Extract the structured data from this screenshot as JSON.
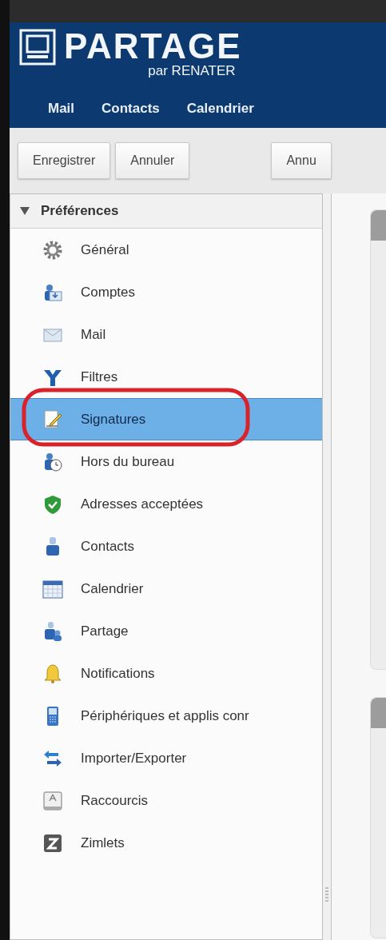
{
  "header": {
    "logo": "PARTAGE",
    "logo_subtitle": "par RENATER"
  },
  "nav": [
    {
      "label": "Mail",
      "selected": false
    },
    {
      "label": "Contacts",
      "selected": false
    },
    {
      "label": "Calendrier",
      "selected": false
    }
  ],
  "toolbar": {
    "buttons": [
      "Enregistrer",
      "Annuler"
    ],
    "right_buttons": [
      "Annu"
    ]
  },
  "sidebar": {
    "title": "Préférences",
    "expanded": true,
    "items": [
      {
        "label": "Général",
        "selected": false
      },
      {
        "label": "Comptes",
        "selected": false
      },
      {
        "label": "Mail",
        "selected": false
      },
      {
        "label": "Filtres",
        "selected": false
      },
      {
        "label": "Signatures",
        "selected": true,
        "circled": true
      },
      {
        "label": "Hors du bureau",
        "selected": false
      },
      {
        "label": "Adresses acceptées",
        "selected": false
      },
      {
        "label": "Contacts",
        "selected": false
      },
      {
        "label": "Calendrier",
        "selected": false
      },
      {
        "label": "Partage",
        "selected": false
      },
      {
        "label": "Notifications",
        "selected": false
      },
      {
        "label": "Périphériques et applis conr",
        "selected": false
      },
      {
        "label": "Importer/Exporter",
        "selected": false
      },
      {
        "label": "Raccourcis",
        "selected": false
      },
      {
        "label": "Zimlets",
        "selected": false
      }
    ]
  }
}
